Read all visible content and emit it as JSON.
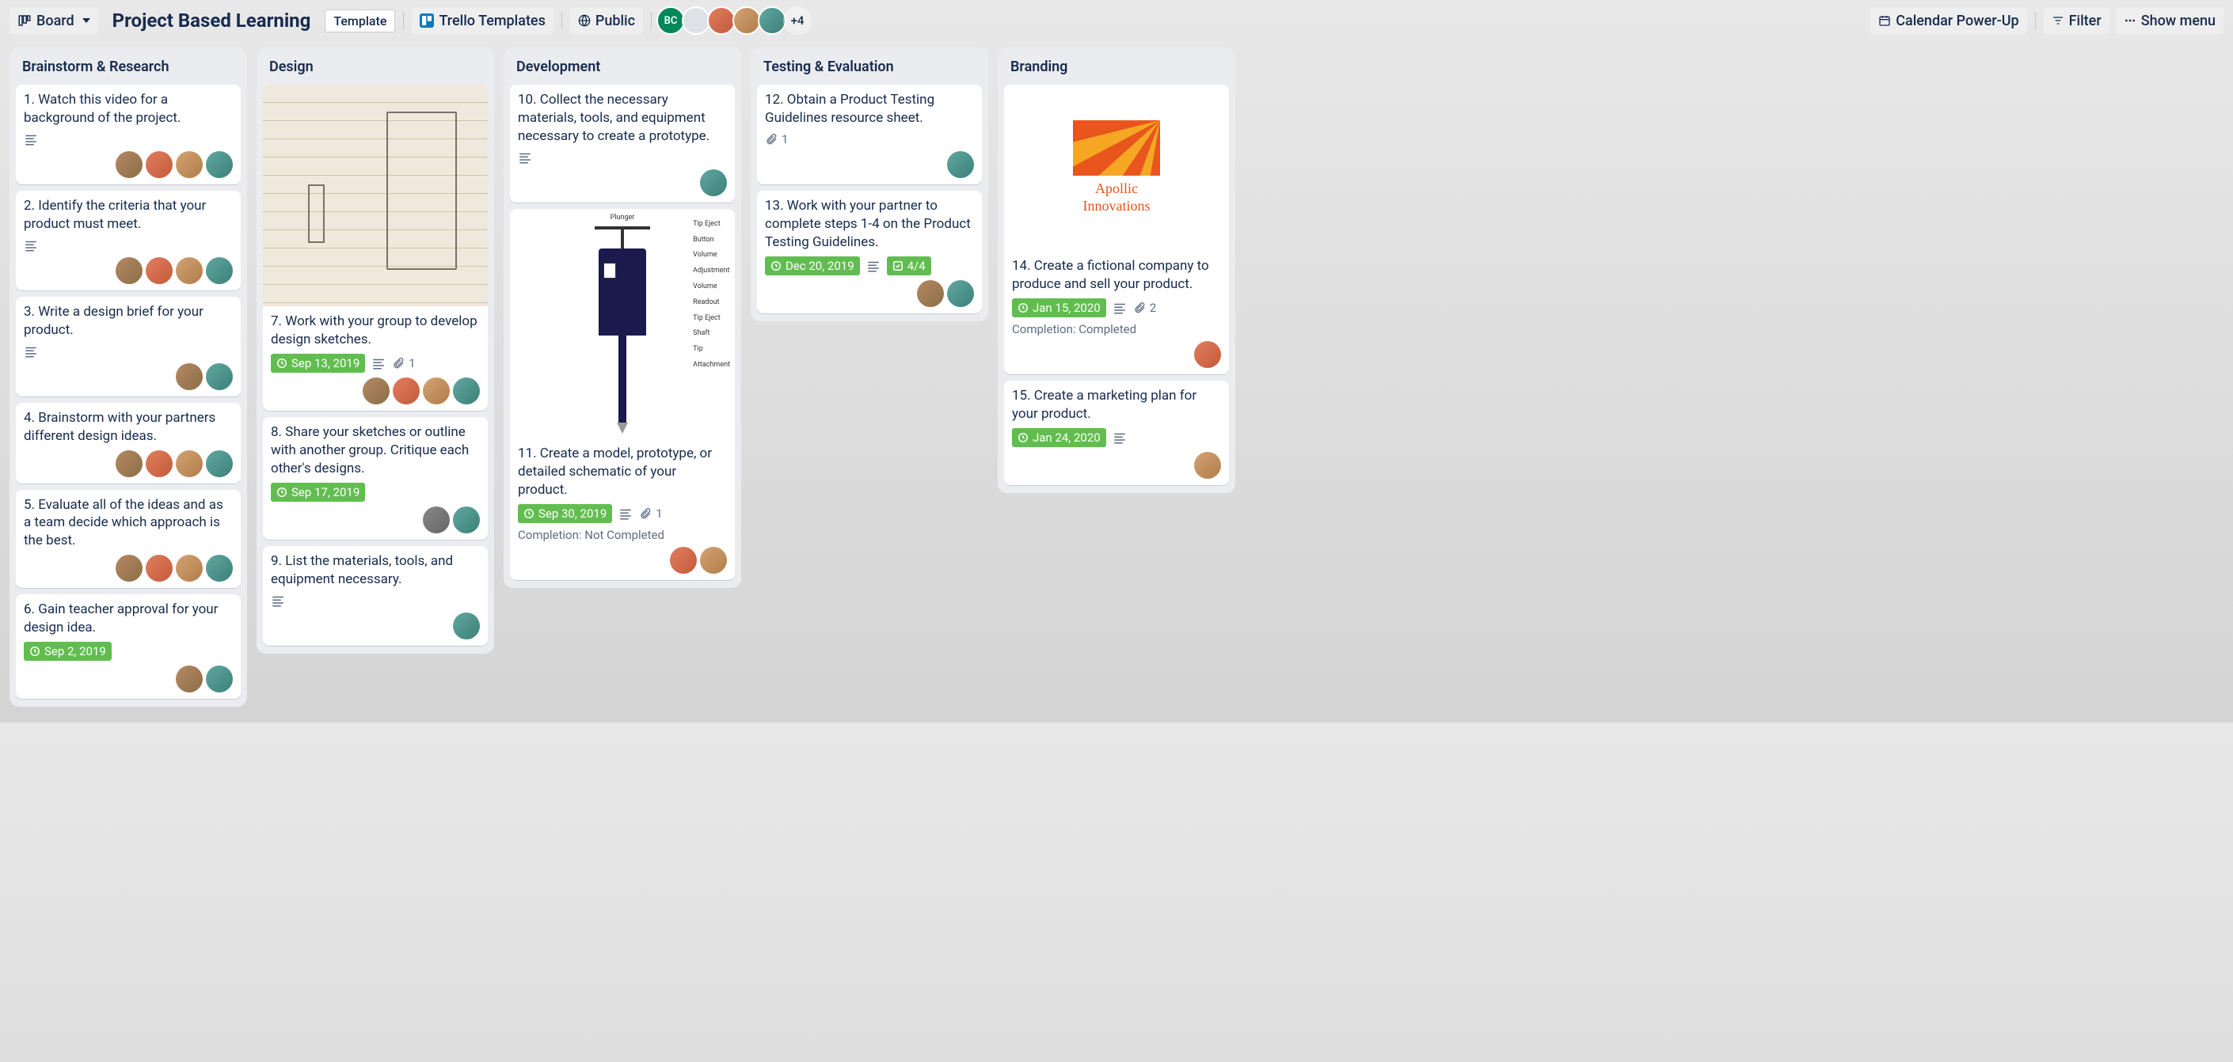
{
  "header": {
    "viewSwitcher": "Board",
    "title": "Project Based Learning",
    "templateBadge": "Template",
    "workspace": "Trello Templates",
    "visibility": "Public",
    "avatarOverflow": "+4",
    "calendarBtn": "Calendar Power-Up",
    "filterBtn": "Filter",
    "showMenuBtn": "Show menu",
    "bcInitials": "BC"
  },
  "lists": [
    {
      "title": "Brainstorm & Research",
      "cards": [
        {
          "title": "1. Watch this video for a background of the project.",
          "desc": true,
          "members": [
            "c1",
            "c2",
            "c3",
            "c4"
          ]
        },
        {
          "title": "2. Identify the criteria that your product must meet.",
          "desc": true,
          "members": [
            "c1",
            "c2",
            "c3",
            "c4"
          ]
        },
        {
          "title": "3. Write a design brief for your product.",
          "desc": true,
          "members": [
            "c1",
            "c4"
          ]
        },
        {
          "title": "4. Brainstorm with your partners different design ideas.",
          "members": [
            "c1",
            "c2",
            "c3",
            "c4"
          ]
        },
        {
          "title": "5. Evaluate all of the ideas and as a team decide which approach is the best.",
          "members": [
            "c1",
            "c2",
            "c3",
            "c4"
          ]
        },
        {
          "title": "6. Gain teacher approval for your design idea.",
          "due": "Sep 2, 2019",
          "members": [
            "c1",
            "c4"
          ]
        }
      ]
    },
    {
      "title": "Design",
      "cards": [
        {
          "cover": "sketch",
          "title": "7. Work with your group to develop design sketches.",
          "due": "Sep 13, 2019",
          "desc": true,
          "attach": "1",
          "members": [
            "c1",
            "c2",
            "c3",
            "c4"
          ]
        },
        {
          "title": "8. Share your sketches or outline with another group. Critique each other's designs.",
          "due": "Sep 17, 2019",
          "members": [
            "c6",
            "c4"
          ]
        },
        {
          "title": "9. List the materials, tools, and equipment necessary.",
          "desc": true,
          "members": [
            "c4"
          ]
        }
      ]
    },
    {
      "title": "Development",
      "cards": [
        {
          "title": "10. Collect the necessary materials, tools, and equipment necessary to create a prototype.",
          "desc": true,
          "members": [
            "c4"
          ]
        },
        {
          "cover": "diagram",
          "title": "11. Create a model, prototype, or detailed schematic of your product.",
          "due": "Sep 30, 2019",
          "desc": true,
          "attach": "1",
          "completion": "Completion: Not Completed",
          "members": [
            "c2",
            "c3"
          ]
        }
      ]
    },
    {
      "title": "Testing & Evaluation",
      "cards": [
        {
          "title": "12. Obtain a Product Testing Guidelines resource sheet.",
          "attach": "1",
          "members": [
            "c4"
          ]
        },
        {
          "title": "13. Work with your partner to complete steps 1-4 on the Product Testing Guidelines.",
          "due": "Dec 20, 2019",
          "desc": true,
          "checklist": "4/4",
          "members": [
            "c1",
            "c4"
          ]
        }
      ]
    },
    {
      "title": "Branding",
      "cards": [
        {
          "cover": "apollic",
          "apollicLine1": "Apollic",
          "apollicLine2": "Innovations",
          "title": "14. Create a fictional company to produce and sell your product.",
          "due": "Jan 15, 2020",
          "desc": true,
          "attach": "2",
          "completion": "Completion: Completed",
          "members": [
            "c2"
          ]
        },
        {
          "title": "15. Create a marketing plan for your product.",
          "due": "Jan 24, 2020",
          "desc": true,
          "members": [
            "c3"
          ]
        }
      ]
    }
  ],
  "diagramLabels": {
    "top": "Plunger",
    "side": "Tip Eject\nButton\nVolume\nAdjustment\nVolume\nReadout\nTip Eject\nShaft\nTip\nAttachment"
  }
}
